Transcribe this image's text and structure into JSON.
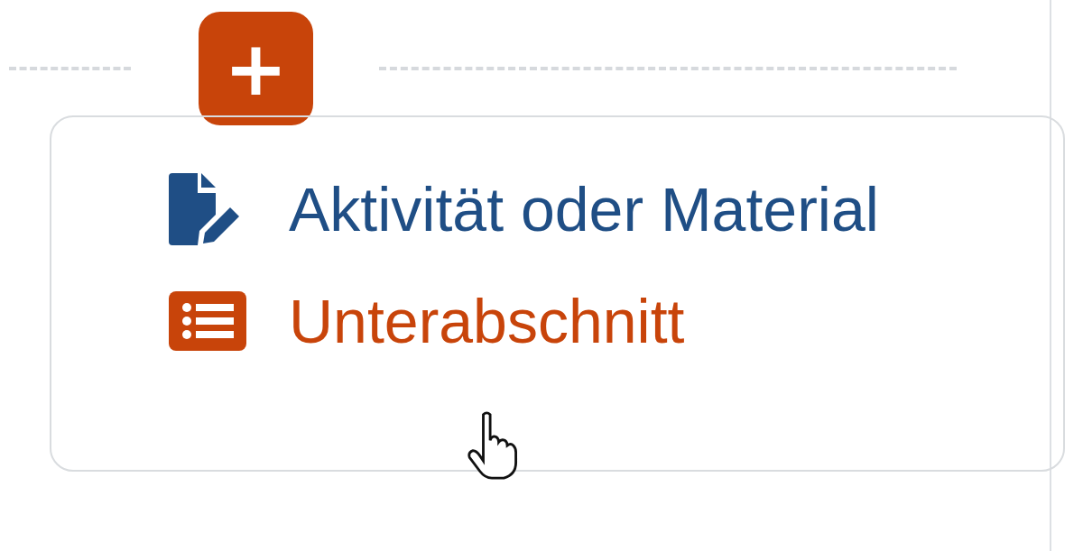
{
  "add_button": {
    "label": "+"
  },
  "menu": {
    "items": [
      {
        "kind": "activity",
        "label": "Aktivität oder Material",
        "selected": false
      },
      {
        "kind": "subsection",
        "label": "Unterabschnitt",
        "selected": true
      }
    ]
  }
}
